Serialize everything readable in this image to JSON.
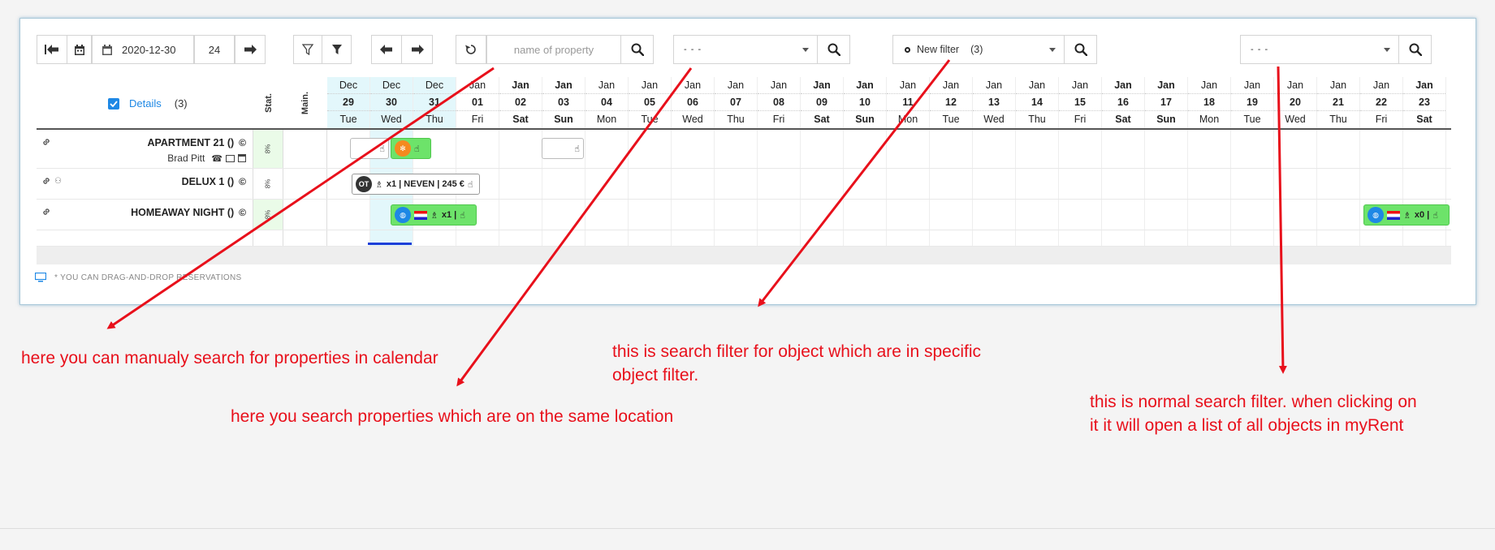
{
  "toolbar": {
    "date": "2020-12-30",
    "days_count": "24",
    "search_placeholder": "name of property",
    "location_select": "- - -",
    "object_filter": "New filter",
    "object_filter_count": "(3)",
    "normal_select": "- - -"
  },
  "grid": {
    "details_label": "Details",
    "details_count": "(3)",
    "col_stat": "Stat.",
    "col_main": "Main.",
    "days": [
      {
        "mon": "Dec",
        "num": "29",
        "dow": "Tue"
      },
      {
        "mon": "Dec",
        "num": "30",
        "dow": "Wed"
      },
      {
        "mon": "Dec",
        "num": "31",
        "dow": "Thu"
      },
      {
        "mon": "Jan",
        "num": "01",
        "dow": "Fri"
      },
      {
        "mon": "Jan",
        "num": "02",
        "dow": "Sat"
      },
      {
        "mon": "Jan",
        "num": "03",
        "dow": "Sun"
      },
      {
        "mon": "Jan",
        "num": "04",
        "dow": "Mon"
      },
      {
        "mon": "Jan",
        "num": "05",
        "dow": "Tue"
      },
      {
        "mon": "Jan",
        "num": "06",
        "dow": "Wed"
      },
      {
        "mon": "Jan",
        "num": "07",
        "dow": "Thu"
      },
      {
        "mon": "Jan",
        "num": "08",
        "dow": "Fri"
      },
      {
        "mon": "Jan",
        "num": "09",
        "dow": "Sat"
      },
      {
        "mon": "Jan",
        "num": "10",
        "dow": "Sun"
      },
      {
        "mon": "Jan",
        "num": "11",
        "dow": "Mon"
      },
      {
        "mon": "Jan",
        "num": "12",
        "dow": "Tue"
      },
      {
        "mon": "Jan",
        "num": "13",
        "dow": "Wed"
      },
      {
        "mon": "Jan",
        "num": "14",
        "dow": "Thu"
      },
      {
        "mon": "Jan",
        "num": "15",
        "dow": "Fri"
      },
      {
        "mon": "Jan",
        "num": "16",
        "dow": "Sat"
      },
      {
        "mon": "Jan",
        "num": "17",
        "dow": "Sun"
      },
      {
        "mon": "Jan",
        "num": "18",
        "dow": "Mon"
      },
      {
        "mon": "Jan",
        "num": "19",
        "dow": "Tue"
      },
      {
        "mon": "Jan",
        "num": "20",
        "dow": "Wed"
      },
      {
        "mon": "Jan",
        "num": "21",
        "dow": "Thu"
      },
      {
        "mon": "Jan",
        "num": "22",
        "dow": "Fri"
      },
      {
        "mon": "Jan",
        "num": "23",
        "dow": "Sat"
      }
    ],
    "properties": [
      {
        "name": "APARTMENT 21 ()",
        "guest": "Brad Pitt",
        "stat": "8%"
      },
      {
        "name": "DELUX 1 ()",
        "stat": "8%"
      },
      {
        "name": "HOMEAWAY NIGHT ()",
        "stat": "8%"
      }
    ],
    "reservations": {
      "delux_badge": "OT",
      "delux_text": "x1 | NEVEN | 245 €",
      "homeaway_text": "x1 |",
      "homeaway_text_2": "x0 |"
    }
  },
  "footer": "* YOU CAN DRAG-AND-DROP RESERVATIONS",
  "annotations": {
    "manual_search": "here you can manualy search for properties in calendar",
    "location_search": "here you search properties which are on the same location",
    "object_filter_l1": "this is search filter for object which are in specific",
    "object_filter_l2": "object filter.",
    "normal_filter_l1": "this is normal search filter. when clicking on",
    "normal_filter_l2": "it it will open a list of all objects in myRent"
  },
  "colors": {
    "accent": "#1e88e5",
    "annotation": "#e8101b",
    "reservation": "#6de36a",
    "today": "#e3f7fb"
  }
}
